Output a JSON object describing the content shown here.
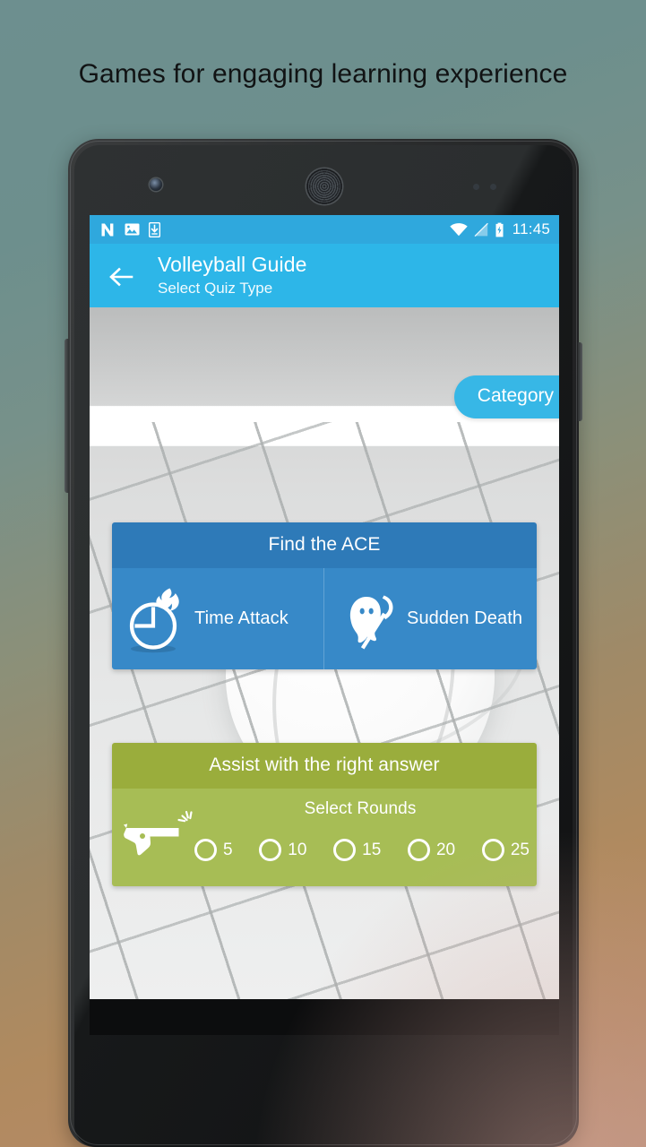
{
  "promo": {
    "headline": "Games for engaging learning experience"
  },
  "status_bar": {
    "time": "11:45",
    "left_icons": [
      "nova-launcher-icon",
      "gallery-image-icon",
      "download-icon"
    ],
    "right_icons": [
      "wifi-icon",
      "cellular-signal-icon",
      "battery-charging-icon"
    ],
    "background_color": "#2fa8dd"
  },
  "app_bar": {
    "back_icon": "back-arrow-icon",
    "title": "Volleyball Guide",
    "subtitle": "Select Quiz Type",
    "background_color": "#2db6e8"
  },
  "content": {
    "category_button": {
      "label": "Category",
      "color": "#37b7e6"
    },
    "quiz_card": {
      "header": "Find the ACE",
      "header_color": "#2e7ab8",
      "body_color": "#3789c8",
      "options": [
        {
          "label": "Time Attack",
          "icon": "clock-flame-icon"
        },
        {
          "label": "Sudden Death",
          "icon": "grim-reaper-ghost-icon"
        }
      ]
    },
    "assist_card": {
      "header": "Assist with the right answer",
      "header_color": "#9aad3c",
      "body_color": "#a7bd55",
      "rounds_label": "Select Rounds",
      "icon": "pistol-icon",
      "rounds": [
        {
          "value": "5",
          "selected": false
        },
        {
          "value": "10",
          "selected": false
        },
        {
          "value": "15",
          "selected": false
        },
        {
          "value": "20",
          "selected": false
        },
        {
          "value": "25",
          "selected": false
        }
      ]
    }
  },
  "nav_bar": {
    "back": "nav-back-triangle-icon",
    "home": "nav-home-circle-icon",
    "recents": "nav-recents-square-icon"
  }
}
